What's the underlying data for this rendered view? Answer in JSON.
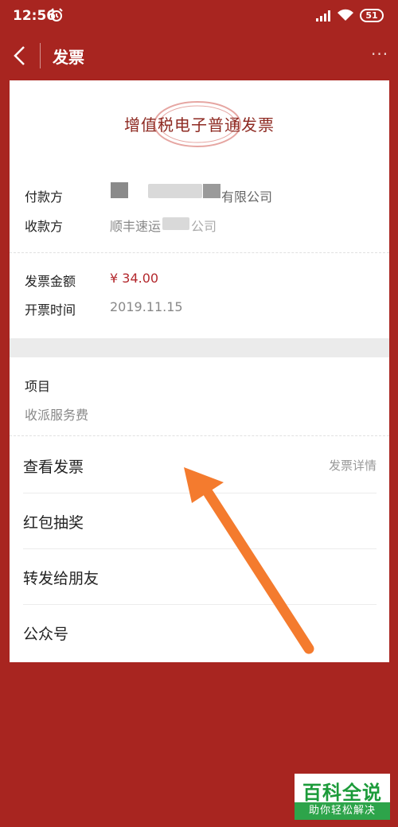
{
  "status_bar": {
    "time": "12:56",
    "battery": "51",
    "icons": [
      "alarm-icon",
      "signal-icon",
      "wifi-icon",
      "battery-icon"
    ]
  },
  "app_bar": {
    "title": "发票",
    "more": "···"
  },
  "invoice": {
    "title": "增值税电子普通发票",
    "payer_label": "付款方",
    "payer_value": "有限公司",
    "payee_label": "收款方",
    "payee_value": "顺丰速运",
    "payee_value_tail": "公司",
    "amount_label": "发票金额",
    "amount_value": "¥ 34.00",
    "date_label": "开票时间",
    "date_value": "2019.11.15",
    "item_label": "项目",
    "item_value": "收派服务费"
  },
  "menu": {
    "items": [
      {
        "label": "查看发票",
        "hint": "发票详情"
      },
      {
        "label": "红包抽奖"
      },
      {
        "label": "转发给朋友"
      },
      {
        "label": "公众号"
      }
    ]
  },
  "watermark": {
    "main": "百科全说",
    "sub": "助你轻松解决"
  },
  "colors": {
    "background": "#a82520",
    "title_red": "#8e2a22",
    "amount_red": "#b3282d",
    "arrow": "#f47b2e"
  }
}
